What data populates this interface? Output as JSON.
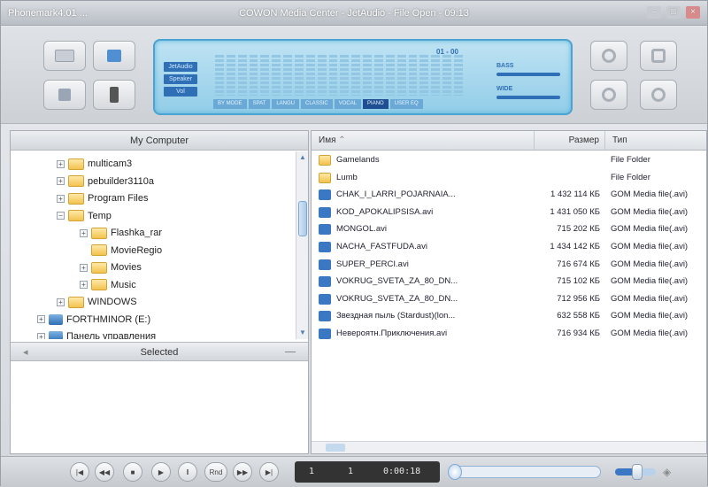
{
  "window": {
    "left_title": "Phonemark4.01 ...",
    "title": "COWON Media Center - JetAudio - File Open - 09:13",
    "btn_min": "–",
    "btn_max": "□",
    "btn_close": "×"
  },
  "lcd": {
    "modes": [
      "JetAudio",
      "Speaker",
      "Vol"
    ],
    "info": "01  -  00",
    "vol1": "BASS",
    "vol2": "WIDE",
    "tabs": [
      "BY MODE",
      "SPAT",
      "LANGU",
      "CLASSIC",
      "VOCAL",
      "PIANO",
      "USER EQ"
    ],
    "active_tab": 5,
    "eq_bars": 22
  },
  "left": {
    "header": "My Computer",
    "tree": [
      {
        "label": "multicam3",
        "level": 1,
        "type": "folder",
        "expander": "+"
      },
      {
        "label": "pebuilder3110a",
        "level": 1,
        "type": "folder",
        "expander": "+"
      },
      {
        "label": "Program Files",
        "level": 1,
        "type": "folder",
        "expander": "+"
      },
      {
        "label": "Temp",
        "level": 1,
        "type": "folder",
        "expander": "−"
      },
      {
        "label": "Flashka_rar",
        "level": 2,
        "type": "folder",
        "expander": "+"
      },
      {
        "label": "MovieRegio",
        "level": 2,
        "type": "folder",
        "expander": ""
      },
      {
        "label": "Movies",
        "level": 2,
        "type": "folder",
        "expander": "+"
      },
      {
        "label": "Music",
        "level": 2,
        "type": "folder",
        "expander": "+"
      },
      {
        "label": "WINDOWS",
        "level": 1,
        "type": "folder",
        "expander": "+"
      },
      {
        "label": "FORTHMINOR (E:)",
        "level": 0,
        "type": "drive",
        "expander": "+"
      },
      {
        "label": "Панель управления",
        "level": 0,
        "type": "drive",
        "expander": "+"
      }
    ],
    "selected_header": "Selected"
  },
  "right": {
    "columns": [
      "Имя",
      "Размер",
      "Тип"
    ],
    "files": [
      {
        "name": "Gamelands",
        "size": "",
        "type": "File Folder",
        "kind": "folder"
      },
      {
        "name": "Lumb",
        "size": "",
        "type": "File Folder",
        "kind": "folder"
      },
      {
        "name": "CHAK_I_LARRI_POJARNAIA...",
        "size": "1 432 114 КБ",
        "type": "GOM Media file(.avi)",
        "kind": "video"
      },
      {
        "name": "KOD_APOKALIPSISA.avi",
        "size": "1 431 050 КБ",
        "type": "GOM Media file(.avi)",
        "kind": "video"
      },
      {
        "name": "MONGOL.avi",
        "size": "715 202 КБ",
        "type": "GOM Media file(.avi)",
        "kind": "video"
      },
      {
        "name": "NACHA_FASTFUDA.avi",
        "size": "1 434 142 КБ",
        "type": "GOM Media file(.avi)",
        "kind": "video"
      },
      {
        "name": "SUPER_PERCI.avi",
        "size": "716 674 КБ",
        "type": "GOM Media file(.avi)",
        "kind": "video"
      },
      {
        "name": "VOKRUG_SVETA_ZA_80_DN...",
        "size": "715 102 КБ",
        "type": "GOM Media file(.avi)",
        "kind": "video"
      },
      {
        "name": "VOKRUG_SVETA_ZA_80_DN...",
        "size": "712 956 КБ",
        "type": "GOM Media file(.avi)",
        "kind": "video"
      },
      {
        "name": "Звездная пыль (Stardust)(lon...",
        "size": "632 558 КБ",
        "type": "GOM Media file(.avi)",
        "kind": "video"
      },
      {
        "name": "Невероятн.Приключения.avi",
        "size": "716 934 КБ",
        "type": "GOM Media file(.avi)",
        "kind": "video"
      }
    ]
  },
  "player": {
    "buttons": [
      "|◀",
      "◀◀",
      "■",
      "▶",
      "‖",
      "Rnd",
      "▶▶",
      "▶|"
    ],
    "track": "1",
    "total": "1",
    "time": "0:00:18",
    "seek_fraction": 0.0,
    "volume_fraction": 0.55
  }
}
